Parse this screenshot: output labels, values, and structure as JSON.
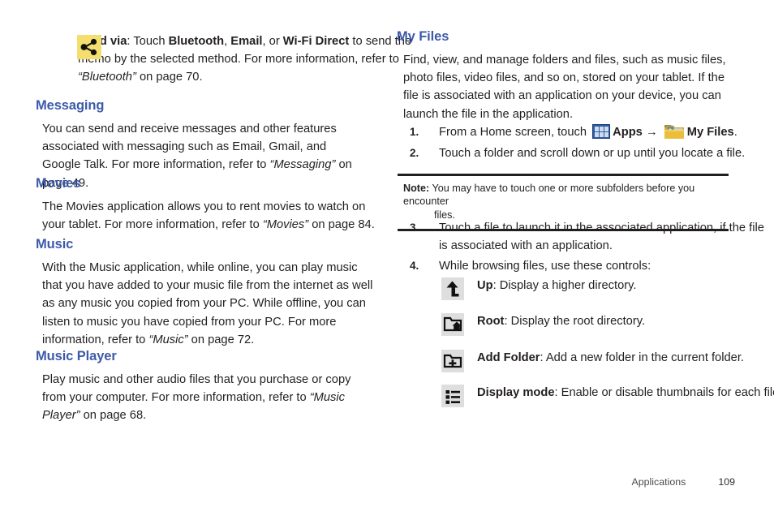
{
  "document": {
    "footer": {
      "section_label": "Applications",
      "page_number": "109"
    },
    "colors": {
      "heading_blue": "#3c5aa9",
      "body_black": "#231f20",
      "share_icon_bg": "#f4de6e",
      "apps_icon_blue": "#2e5fa3",
      "folder_gold": "#e5b834",
      "control_icon_bg": "#dedede"
    }
  },
  "left_column": {
    "send_via_note": {
      "icon": "share-icon",
      "lead": "Send via",
      "text_1": ": Touch ",
      "bold_1": "Bluetooth",
      "text_2": ", ",
      "bold_2": "Email",
      "text_3": ", or ",
      "bold_3": "Wi-Fi Direct",
      "text_4": " to send the memo by the selected method. For more information, refer to ",
      "italic_ref": "“Bluetooth”",
      "text_5": " on page 70."
    },
    "sections": [
      {
        "heading": "Messaging",
        "text_before": "You can send and receive messages and other features associated with messaging such as Email, Gmail, and Google Talk. For more information, refer to ",
        "italic_ref": "“Messaging”",
        "text_after": " on page 49."
      },
      {
        "heading": "Movies",
        "text_before": "The Movies application allows you to rent movies to watch on your tablet. For more information, refer to ",
        "italic_ref": "“Movies”",
        "text_after": " on page 84."
      },
      {
        "heading": "Music",
        "text_before": "With the Music application, while online, you can play music that you have added to your music file from the internet as well as any music you copied from your PC. While offline, you can listen to music you have copied from your PC. For more information, refer to ",
        "italic_ref": "“Music”",
        "text_after": " on page 72."
      },
      {
        "heading": "Music Player",
        "text_before": "Play music and other audio files that you purchase or copy from your computer. For more information, refer to ",
        "italic_ref": "“Music Player”",
        "text_after": " on page 68."
      }
    ]
  },
  "right_column": {
    "heading": "My Files",
    "intro": "Find, view, and manage folders and files, such as music files, photo files, video files, and so on, stored on your tablet. If the file is associated with an application on your device, you can launch the file in the application.",
    "step1": {
      "number": "1.",
      "text_before": "From a Home screen, touch ",
      "apps_label": "Apps",
      "arrow": "→",
      "my_files_label": "My Files",
      "text_after": "."
    },
    "step2": {
      "number": "2.",
      "text": "Touch a folder and scroll down or up until you locate a file."
    },
    "note": {
      "label": "Note:",
      "line1": "You may have to touch one or more subfolders before you encounter",
      "line2": "files."
    },
    "step3": {
      "number": "3.",
      "text": "Touch a file to launch it in the associated application, if the file is associated with an application."
    },
    "step4": {
      "number": "4.",
      "text": "While browsing files, use these controls:"
    },
    "controls": [
      {
        "icon": "up-arrow-icon",
        "label": "Up",
        "description": ": Display a higher directory."
      },
      {
        "icon": "folder-home-icon",
        "label": "Root",
        "description": ": Display the root directory."
      },
      {
        "icon": "folder-plus-icon",
        "label": "Add Folder",
        "description": ": Add a new folder in the current folder."
      },
      {
        "icon": "list-view-icon",
        "label": "Display mode",
        "description": ": Enable or disable thumbnails for each file."
      }
    ]
  }
}
